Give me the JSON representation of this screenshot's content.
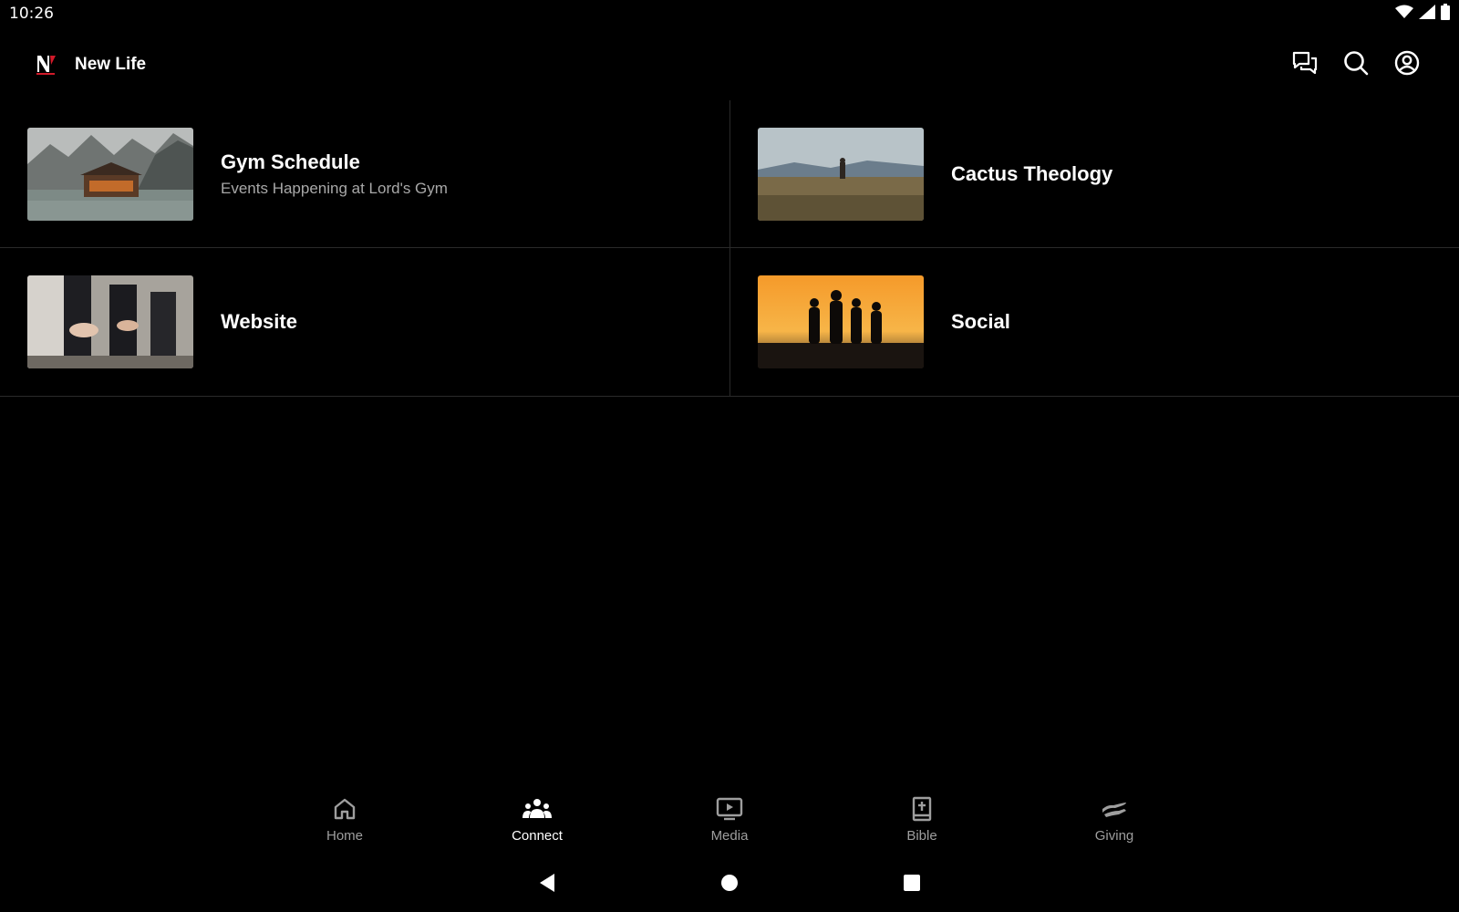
{
  "status_bar": {
    "time": "10:26"
  },
  "header": {
    "title": "New Life"
  },
  "tiles": [
    {
      "title": "Gym Schedule",
      "subtitle": "Events Happening at Lord's Gym"
    },
    {
      "title": "Cactus Theology",
      "subtitle": ""
    },
    {
      "title": "Website",
      "subtitle": ""
    },
    {
      "title": "Social",
      "subtitle": ""
    }
  ],
  "bottom_nav": {
    "items": [
      {
        "label": "Home",
        "icon": "home-icon"
      },
      {
        "label": "Connect",
        "icon": "people-icon"
      },
      {
        "label": "Media",
        "icon": "tv-play-icon"
      },
      {
        "label": "Bible",
        "icon": "bible-icon"
      },
      {
        "label": "Giving",
        "icon": "giving-hand-icon"
      }
    ],
    "active": "Connect"
  },
  "colors": {
    "background": "#000000",
    "text_primary": "#ffffff",
    "text_secondary": "#a8a8a8",
    "divider": "#2a2a2a",
    "nav_inactive": "#9e9e9e"
  }
}
